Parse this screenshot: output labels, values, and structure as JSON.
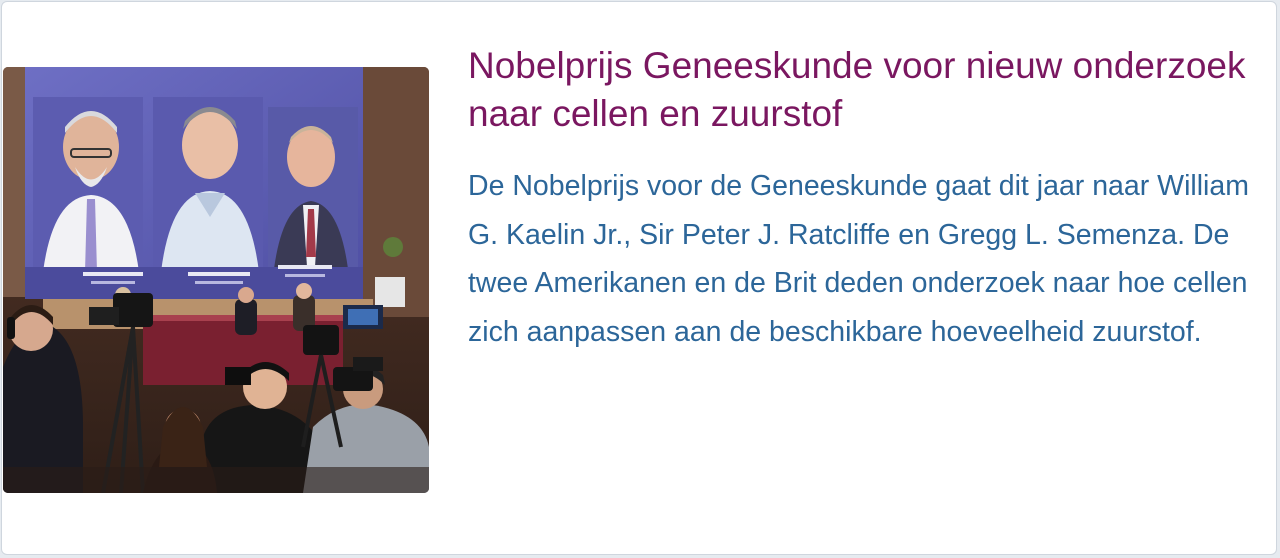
{
  "article": {
    "title": "Nobelprijs Geneeskunde voor nieuw onderzoek naar cellen en zuurstof",
    "summary": "De Nobelprijs voor de Geneeskunde gaat dit jaar naar William G. Kaelin Jr., Sir Peter J. Ratcliffe en Gregg L. Semenza. De twee Amerikanen en de Brit deden onderzoek naar hoe cellen zich aanpassen aan de beschikbare hoeveelheid zuurstof.",
    "image": {
      "subject": "nobel-prize-announcement-photo",
      "screen_captions": [
        "Gregg L. Semenza",
        "Sir Peter J. Ratcliffe",
        "William G. Kaelin, Jr"
      ]
    }
  },
  "colors": {
    "title": "#7a1760",
    "summary": "#2c6699",
    "background": "#ffffff",
    "border": "#cfd6de"
  }
}
